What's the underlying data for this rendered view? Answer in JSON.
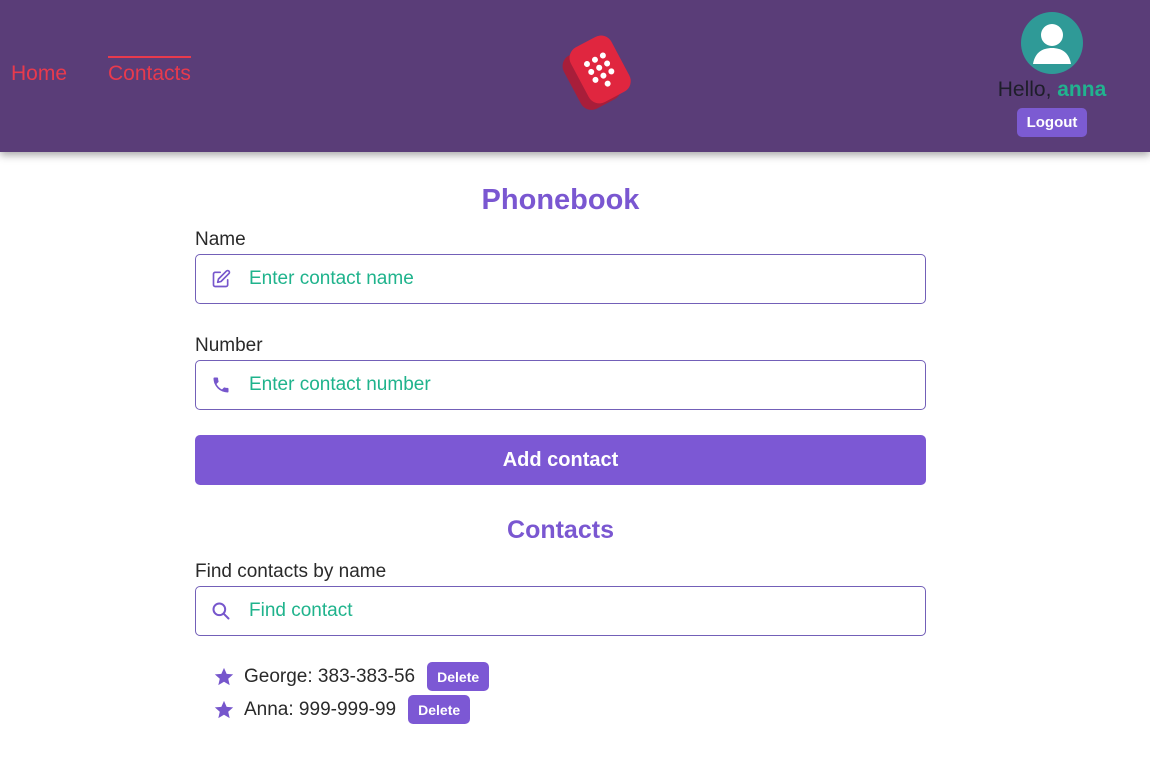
{
  "nav": {
    "home_label": "Home",
    "contacts_label": "Contacts"
  },
  "user": {
    "greeting_prefix": "Hello, ",
    "username": "anna",
    "logout_label": "Logout"
  },
  "colors": {
    "header_bg": "#5a3d78",
    "accent": "#7c58d4",
    "nav_link": "#e83a4d",
    "placeholder_text": "#1fb38c",
    "avatar_bg": "#2f9a97"
  },
  "phonebook": {
    "title": "Phonebook",
    "name_label": "Name",
    "name_placeholder": "Enter contact name",
    "name_icon": "edit-icon",
    "number_label": "Number",
    "number_placeholder": "Enter contact number",
    "number_icon": "phone-icon",
    "add_label": "Add contact"
  },
  "contacts": {
    "title": "Contacts",
    "filter_label": "Find contacts by name",
    "filter_placeholder": "Find contact",
    "filter_icon": "search-icon",
    "items": [
      {
        "text": "George: 383-383-56",
        "delete_label": "Delete"
      },
      {
        "text": "Anna: 999-999-99",
        "delete_label": "Delete"
      }
    ]
  }
}
